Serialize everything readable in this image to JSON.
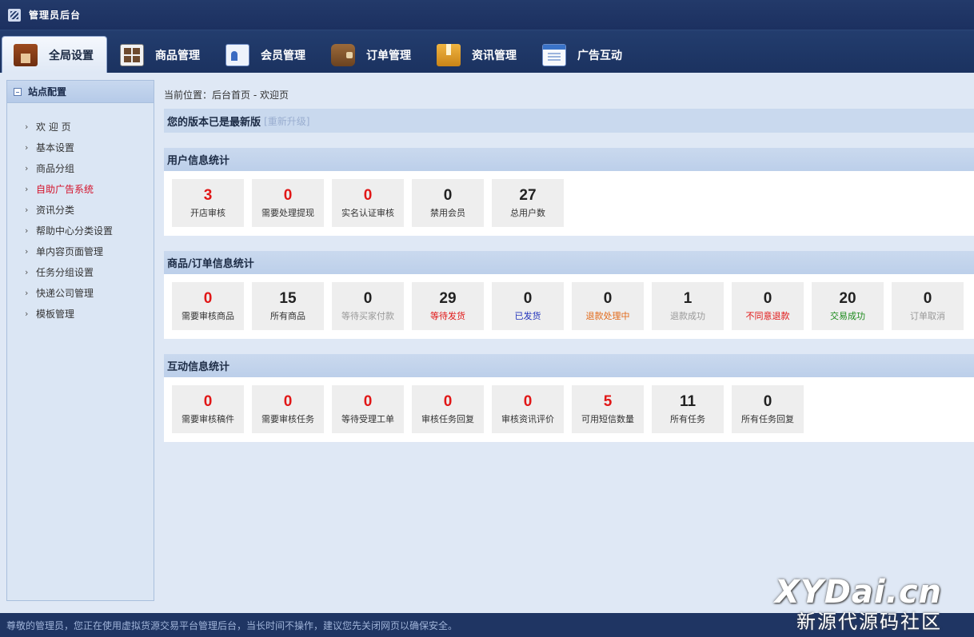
{
  "app": {
    "title": "管理员后台"
  },
  "nav": {
    "tabs": [
      {
        "label": "全局设置",
        "icon": "home-icon",
        "active": true
      },
      {
        "label": "商品管理",
        "icon": "goods-grid-icon"
      },
      {
        "label": "会员管理",
        "icon": "member-card-icon"
      },
      {
        "label": "订单管理",
        "icon": "wallet-icon"
      },
      {
        "label": "资讯管理",
        "icon": "box-icon"
      },
      {
        "label": "广告互动",
        "icon": "document-list-icon"
      }
    ]
  },
  "sidebar": {
    "header": "站点配置",
    "items": [
      {
        "label": "欢 迎 页"
      },
      {
        "label": "基本设置"
      },
      {
        "label": "商品分组"
      },
      {
        "label": "自助广告系统",
        "active": true
      },
      {
        "label": "资讯分类"
      },
      {
        "label": "帮助中心分类设置"
      },
      {
        "label": "单内容页面管理"
      },
      {
        "label": "任务分组设置"
      },
      {
        "label": "快递公司管理"
      },
      {
        "label": "模板管理"
      }
    ]
  },
  "main": {
    "breadcrumb": "当前位置：后台首页 - 欢迎页",
    "version": {
      "text": "您的版本已是最新版",
      "upgrade": "[重新升级]"
    },
    "sections": [
      {
        "title": "用户信息统计",
        "cards": [
          {
            "value": "3",
            "label": "开店审核",
            "num_color": "red"
          },
          {
            "value": "0",
            "label": "需要处理提现",
            "num_color": "red"
          },
          {
            "value": "0",
            "label": "实名认证审核",
            "num_color": "red"
          },
          {
            "value": "0",
            "label": "禁用会员",
            "num_color": "dark"
          },
          {
            "value": "27",
            "label": "总用户数",
            "num_color": "dark"
          }
        ]
      },
      {
        "title": "商品/订单信息统计",
        "cards": [
          {
            "value": "0",
            "label": "需要审核商品",
            "num_color": "red"
          },
          {
            "value": "15",
            "label": "所有商品",
            "num_color": "dark"
          },
          {
            "value": "0",
            "label": "等待买家付款",
            "num_color": "dark",
            "label_color": "gray"
          },
          {
            "value": "29",
            "label": "等待发货",
            "num_color": "dark",
            "label_color": "red"
          },
          {
            "value": "0",
            "label": "已发货",
            "num_color": "dark",
            "label_color": "blue"
          },
          {
            "value": "0",
            "label": "退款处理中",
            "num_color": "dark",
            "label_color": "orange"
          },
          {
            "value": "1",
            "label": "退款成功",
            "num_color": "dark",
            "label_color": "gray"
          },
          {
            "value": "0",
            "label": "不同意退款",
            "num_color": "dark",
            "label_color": "red"
          },
          {
            "value": "20",
            "label": "交易成功",
            "num_color": "dark",
            "label_color": "green"
          },
          {
            "value": "0",
            "label": "订单取消",
            "num_color": "dark",
            "label_color": "gray"
          }
        ]
      },
      {
        "title": "互动信息统计",
        "cards": [
          {
            "value": "0",
            "label": "需要审核稿件",
            "num_color": "red"
          },
          {
            "value": "0",
            "label": "需要审核任务",
            "num_color": "red"
          },
          {
            "value": "0",
            "label": "等待受理工单",
            "num_color": "red"
          },
          {
            "value": "0",
            "label": "审核任务回复",
            "num_color": "red"
          },
          {
            "value": "0",
            "label": "审核资讯评价",
            "num_color": "red"
          },
          {
            "value": "5",
            "label": "可用短信数量",
            "num_color": "red"
          },
          {
            "value": "11",
            "label": "所有任务",
            "num_color": "dark"
          },
          {
            "value": "0",
            "label": "所有任务回复",
            "num_color": "dark"
          }
        ]
      }
    ]
  },
  "footer": {
    "text": "尊敬的管理员，您正在使用虚拟货源交易平台管理后台，当长时间不操作，建议您先关闭网页以确保安全。"
  },
  "watermark": {
    "main": "XYDai.cn",
    "sub": "新源代源码社区"
  }
}
